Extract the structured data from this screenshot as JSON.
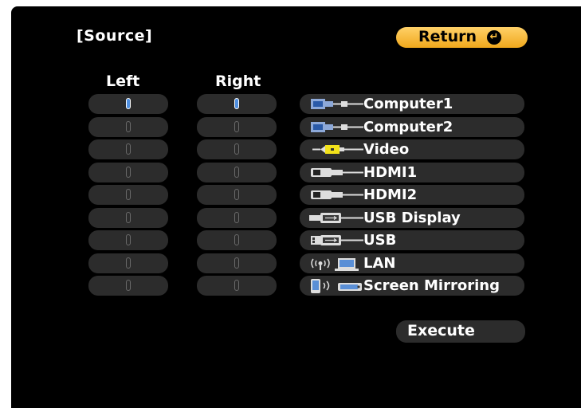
{
  "title": "[Source]",
  "return_button": {
    "label": "Return"
  },
  "columns": {
    "left": "Left",
    "right": "Right"
  },
  "selected": {
    "left_row": 0,
    "right_row": 0
  },
  "sources": [
    {
      "label": "Computer1",
      "icon": "computer-port-icon"
    },
    {
      "label": "Computer2",
      "icon": "computer-port-icon"
    },
    {
      "label": "Video",
      "icon": "video-cable-icon"
    },
    {
      "label": "HDMI1",
      "icon": "hdmi-cable-icon"
    },
    {
      "label": "HDMI2",
      "icon": "hdmi-cable-icon"
    },
    {
      "label": "USB Display",
      "icon": "usb-display-icon"
    },
    {
      "label": "USB",
      "icon": "usb-icon"
    },
    {
      "label": "LAN",
      "icon": "lan-icon"
    },
    {
      "label": "Screen Mirroring",
      "icon": "screen-mirroring-icon"
    }
  ],
  "execute_button": {
    "label": "Execute"
  },
  "colors": {
    "accent": "#f7b733",
    "selection": "#4f8fe0",
    "cell": "#2c2c2c",
    "background": "#000000"
  }
}
